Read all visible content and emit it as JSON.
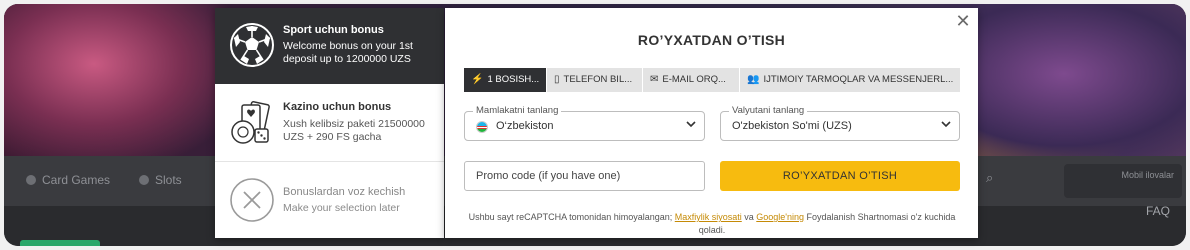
{
  "background": {
    "nav": [
      "Card Games",
      "Slots"
    ],
    "side_label": "Mobil ilovalar",
    "faq": "FAQ"
  },
  "bonus_panel": {
    "items": [
      {
        "title": "Sport uchun bonus",
        "description": "Welcome bonus on your 1st deposit up to 1200000 UZS",
        "icon": "soccer-ball-icon",
        "state": "selected"
      },
      {
        "title": "Kazino uchun bonus",
        "description": "Xush kelibsiz paketi 21500000 UZS + 290 FS gacha",
        "icon": "casino-cards-dice-icon",
        "state": "normal"
      },
      {
        "title": "Bonuslardan voz kechish",
        "description": "Make your selection later",
        "icon": "cancel-x-icon",
        "state": "muted"
      }
    ]
  },
  "modal": {
    "title": "RO’YXATDAN O’TISH",
    "close_icon": "close-icon",
    "tabs": [
      {
        "label": "1 BOSISH...",
        "icon": "lightning-icon",
        "selected": true
      },
      {
        "label": "TELEFON BIL...",
        "icon": "phone-icon",
        "selected": false
      },
      {
        "label": "E-MAIL ORQ...",
        "icon": "envelope-icon",
        "selected": false
      },
      {
        "label": "IJTIMOIY TARMOQLAR VA MESSENJERL...",
        "icon": "users-icon",
        "selected": false
      }
    ],
    "country": {
      "label": "Mamlakatni tanlang",
      "value": "O‘zbekiston",
      "flag": "uzbekistan-flag-icon"
    },
    "currency": {
      "label": "Valyutani tanlang",
      "value": "O'zbekiston So'mi (UZS)"
    },
    "promo_placeholder": "Promo code (if you have one)",
    "submit_label": "RO’YXATDAN O’TISH",
    "legal": {
      "before": "Ushbu sayt reCAPTCHA tomonidan himoyalangan; ",
      "privacy_link": "Maxfiylik siyosati",
      "middle": " va ",
      "google_link": "Google'ning",
      "after": " Foydalanish Shartnomasi o'z kuchida qoladi."
    }
  },
  "colors": {
    "accent": "#f7bb0f",
    "dark": "#2f3033",
    "link": "#c58a06"
  }
}
